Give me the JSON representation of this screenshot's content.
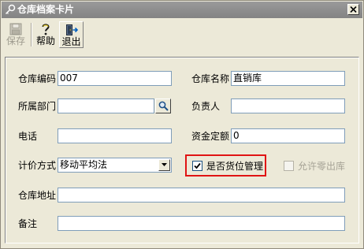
{
  "window": {
    "title": "仓库档案卡片"
  },
  "toolbar": {
    "save_label": "保存",
    "help_label": "帮助",
    "exit_label": "退出"
  },
  "form": {
    "warehouse_code": {
      "label": "仓库编码",
      "value": "007"
    },
    "warehouse_name": {
      "label": "仓库名称",
      "value": "直销库"
    },
    "department": {
      "label": "所属部门",
      "value": ""
    },
    "manager": {
      "label": "负责人",
      "value": ""
    },
    "phone": {
      "label": "电话",
      "value": ""
    },
    "fund_quota": {
      "label": "资金定额",
      "value": "0"
    },
    "pricing_method": {
      "label": "计价方式",
      "value": "移动平均法"
    },
    "location_managed": {
      "label": "是否货位管理",
      "checked": true
    },
    "allow_zero_out": {
      "label": "允许零出库",
      "checked": false,
      "disabled": true
    },
    "address": {
      "label": "仓库地址",
      "value": ""
    },
    "remark": {
      "label": "备注",
      "value": ""
    }
  },
  "colors": {
    "highlight": "#e01414",
    "titlebar": "#8c8c8c"
  }
}
